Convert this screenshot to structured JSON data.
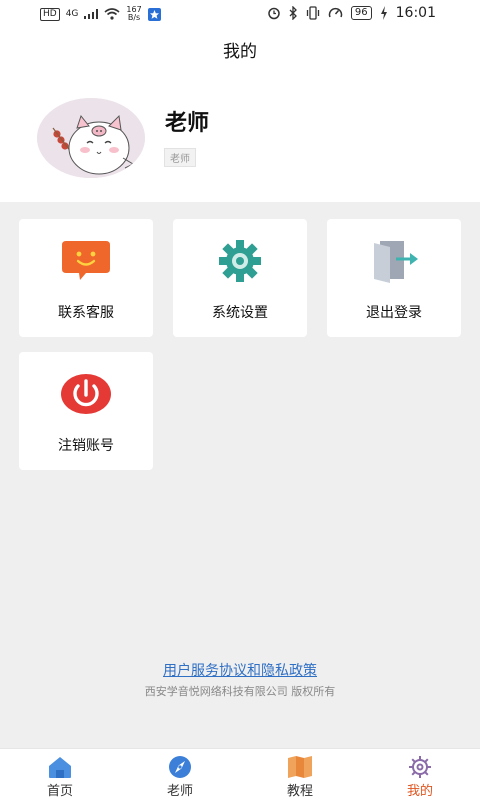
{
  "status_bar": {
    "hd": "HD",
    "network": "4G",
    "speed_value": "167",
    "speed_unit": "B/s",
    "battery": "96",
    "time": "16:01"
  },
  "header": {
    "title": "我的"
  },
  "profile": {
    "name": "老师",
    "role": "老师"
  },
  "menu": {
    "items": [
      {
        "label": "联系客服",
        "icon": "chat-smile-icon"
      },
      {
        "label": "系统设置",
        "icon": "gear-icon"
      },
      {
        "label": "退出登录",
        "icon": "logout-door-icon"
      },
      {
        "label": "注销账号",
        "icon": "power-icon"
      }
    ]
  },
  "footer": {
    "link": "用户服务协议和隐私政策",
    "copyright": "西安学音悦网络科技有限公司 版权所有"
  },
  "tabbar": {
    "items": [
      {
        "label": "首页",
        "icon": "home-icon"
      },
      {
        "label": "老师",
        "icon": "compass-icon"
      },
      {
        "label": "教程",
        "icon": "book-icon"
      },
      {
        "label": "我的",
        "icon": "ship-wheel-icon"
      }
    ],
    "active_index": 3
  },
  "colors": {
    "accent": "#e0551f",
    "link": "#2f6fc4",
    "chat_icon": "#f0672b",
    "gear_icon": "#2f9e93",
    "power_icon": "#e53935"
  }
}
